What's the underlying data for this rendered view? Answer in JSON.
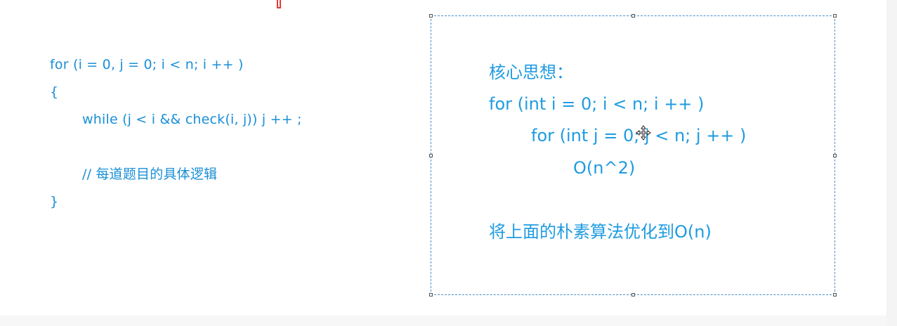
{
  "code": {
    "line1": "for (i = 0, j = 0; i < n; i ++ )",
    "line2": "{",
    "line3": "while (j < i && check(i, j)) j ++ ;",
    "line4": "// 每道题目的具体逻辑",
    "line5": "}"
  },
  "text_box": {
    "heading": "核心思想：",
    "outer_loop": "for (int i = 0; i < n; i ++ )",
    "inner_loop": "for (int j = 0; j < n; j ++ )",
    "complexity": "O(n^2)",
    "summary": "将上面的朴素算法优化到O(n)"
  },
  "icons": {
    "move_cursor": "move-cursor-icon",
    "text_cursor": "text-cursor-icon"
  },
  "colors": {
    "text": "#1e9be0",
    "selection_border": "#4a8fc7"
  }
}
